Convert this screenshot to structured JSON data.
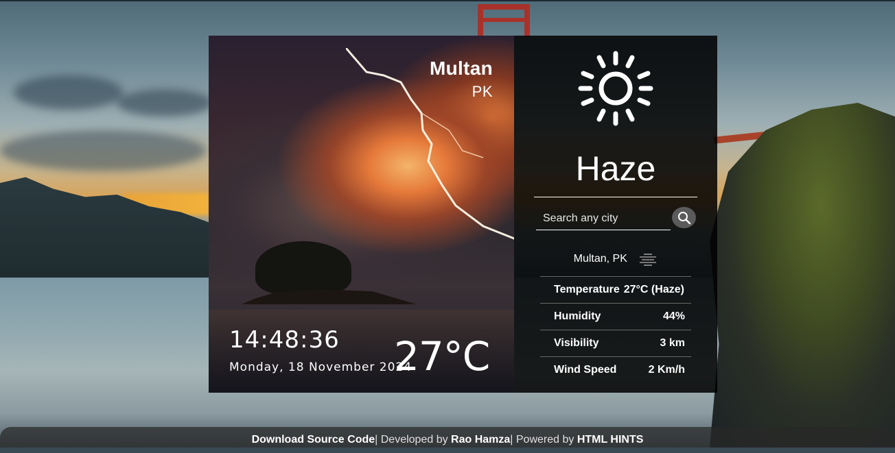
{
  "location": {
    "city": "Multan",
    "country": "PK",
    "combined": "Multan, PK"
  },
  "clock": {
    "time": "14:48:36",
    "date": "Monday, 18 November 2024"
  },
  "current": {
    "temp_display": "27°C",
    "condition": "Haze"
  },
  "search": {
    "placeholder": "Search any city"
  },
  "stats": [
    {
      "label": "Temperature",
      "value": "27°C (Haze)"
    },
    {
      "label": "Humidity",
      "value": "44%"
    },
    {
      "label": "Visibility",
      "value": "3 km"
    },
    {
      "label": "Wind Speed",
      "value": "2 Km/h"
    }
  ],
  "icons": {
    "weather": "sun-icon",
    "condition_small": "haze-icon",
    "search": "search-icon"
  },
  "footer": {
    "download_link": "Download Source Code",
    "developed_by": "| Developed by ",
    "author": "Rao Hamza",
    "powered_by": "| Powered by ",
    "powered_link": "HTML HINTS"
  },
  "colors": {
    "panel_bg": "#000000",
    "text": "#ffffff",
    "search_button": "#5b5b5b"
  }
}
